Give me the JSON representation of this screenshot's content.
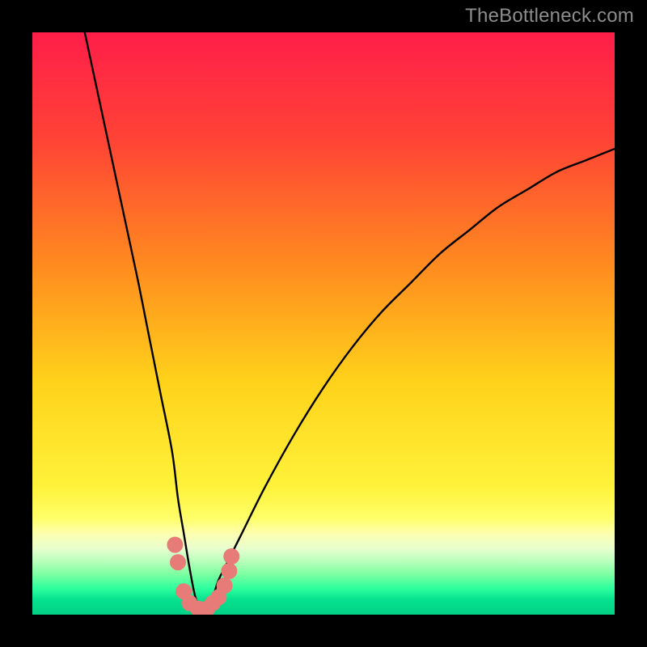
{
  "watermark": "TheBottleneck.com",
  "chart_data": {
    "type": "line",
    "title": "",
    "xlabel": "",
    "ylabel": "",
    "xlim": [
      0,
      100
    ],
    "ylim": [
      0,
      100
    ],
    "curve_description": "V-shaped bottleneck curve: steep descent from top-left to a minimum near x≈28, then a concave rise toward the upper right, flattening slightly at the far right.",
    "minimum_x_pct": 28,
    "series": [
      {
        "name": "bottleneck-curve",
        "x_pct": [
          9,
          12,
          15,
          18,
          20,
          22,
          24,
          25,
          26,
          27,
          28,
          29,
          30,
          31,
          32,
          34,
          36,
          40,
          45,
          50,
          55,
          60,
          65,
          70,
          75,
          80,
          85,
          90,
          95,
          100
        ],
        "y_pct": [
          100,
          86,
          72,
          58,
          48,
          38,
          28,
          20,
          14,
          8,
          3,
          1,
          1,
          3,
          6,
          10,
          14,
          22,
          31,
          39,
          46,
          52,
          57,
          62,
          66,
          70,
          73,
          76,
          78,
          80
        ]
      }
    ],
    "markers": {
      "name": "highlighted-points",
      "color": "#e77b78",
      "radius_px": 10,
      "points_pct": [
        [
          24.5,
          12
        ],
        [
          25.0,
          9
        ],
        [
          26.0,
          4
        ],
        [
          27.0,
          2
        ],
        [
          28.5,
          1
        ],
        [
          30.0,
          1
        ],
        [
          31.0,
          2
        ],
        [
          32.0,
          3
        ],
        [
          33.0,
          5
        ],
        [
          33.8,
          7.5
        ],
        [
          34.2,
          10
        ]
      ]
    },
    "gradient_bands": [
      {
        "stop": 0.0,
        "color": "#ff1e49"
      },
      {
        "stop": 0.18,
        "color": "#ff4236"
      },
      {
        "stop": 0.4,
        "color": "#ff8b1f"
      },
      {
        "stop": 0.6,
        "color": "#ffd21a"
      },
      {
        "stop": 0.78,
        "color": "#fff23a"
      },
      {
        "stop": 0.835,
        "color": "#ffff6a"
      },
      {
        "stop": 0.86,
        "color": "#fdffae"
      },
      {
        "stop": 0.885,
        "color": "#eaffce"
      },
      {
        "stop": 0.905,
        "color": "#c0ffbf"
      },
      {
        "stop": 0.93,
        "color": "#7effa2"
      },
      {
        "stop": 0.955,
        "color": "#2dff9e"
      },
      {
        "stop": 0.975,
        "color": "#05e08e"
      },
      {
        "stop": 1.0,
        "color": "#03d186"
      }
    ]
  }
}
